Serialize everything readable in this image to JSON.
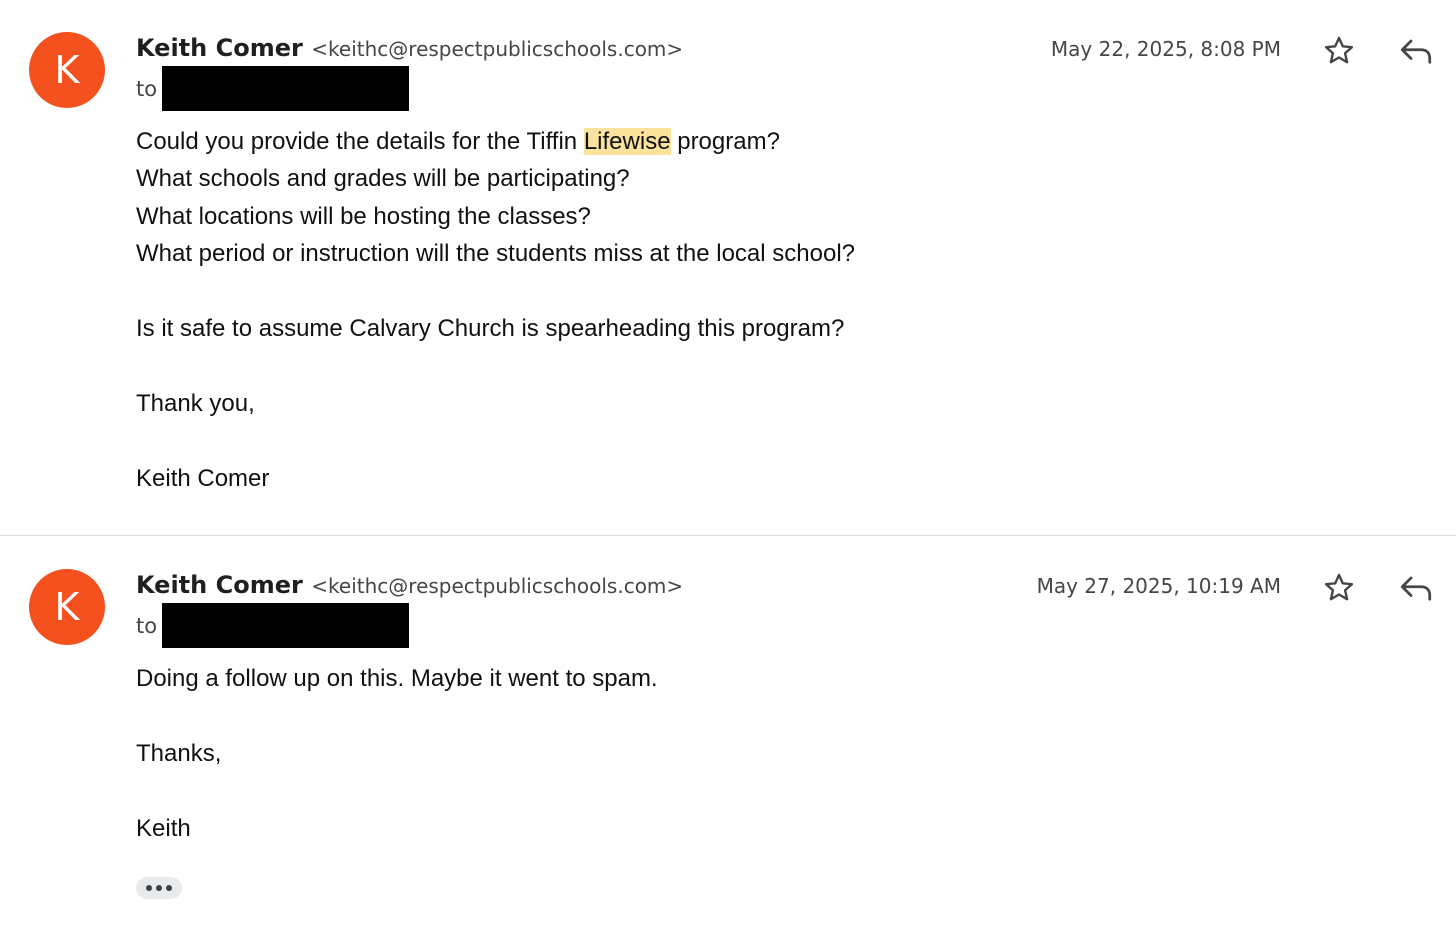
{
  "messages": [
    {
      "avatar_letter": "K",
      "avatar_color": "#f4511e",
      "sender_name": "Keith Comer",
      "sender_email": "<keithc@respectpublicschools.com>",
      "to_label": "to",
      "date": "May 22, 2025, 8:08 PM",
      "body": {
        "line1_before": "Could you provide the details for the Tiffin ",
        "line1_highlight": "Lifewise",
        "line1_after": " program?",
        "line2": "What schools and grades will be participating?",
        "line3": "What locations will be hosting the classes?",
        "line4": "What period or instruction will the students miss at the local school?",
        "line5": "Is it safe to assume Calvary Church is spearheading this program?",
        "line6": "Thank you,",
        "line7": "Keith Comer"
      }
    },
    {
      "avatar_letter": "K",
      "avatar_color": "#f4511e",
      "sender_name": "Keith Comer",
      "sender_email": "<keithc@respectpublicschools.com>",
      "to_label": "to",
      "date": "May 27, 2025, 10:19 AM",
      "body": {
        "line1": "Doing a follow up on this. Maybe it went to spam.",
        "line2": "Thanks,",
        "line3": "Keith"
      }
    }
  ],
  "icons": {
    "star": "star-outline-icon",
    "reply": "reply-icon",
    "more": "more-horizontal-icon"
  },
  "colors": {
    "highlight": "#fbe39e",
    "redaction": "#000000"
  }
}
